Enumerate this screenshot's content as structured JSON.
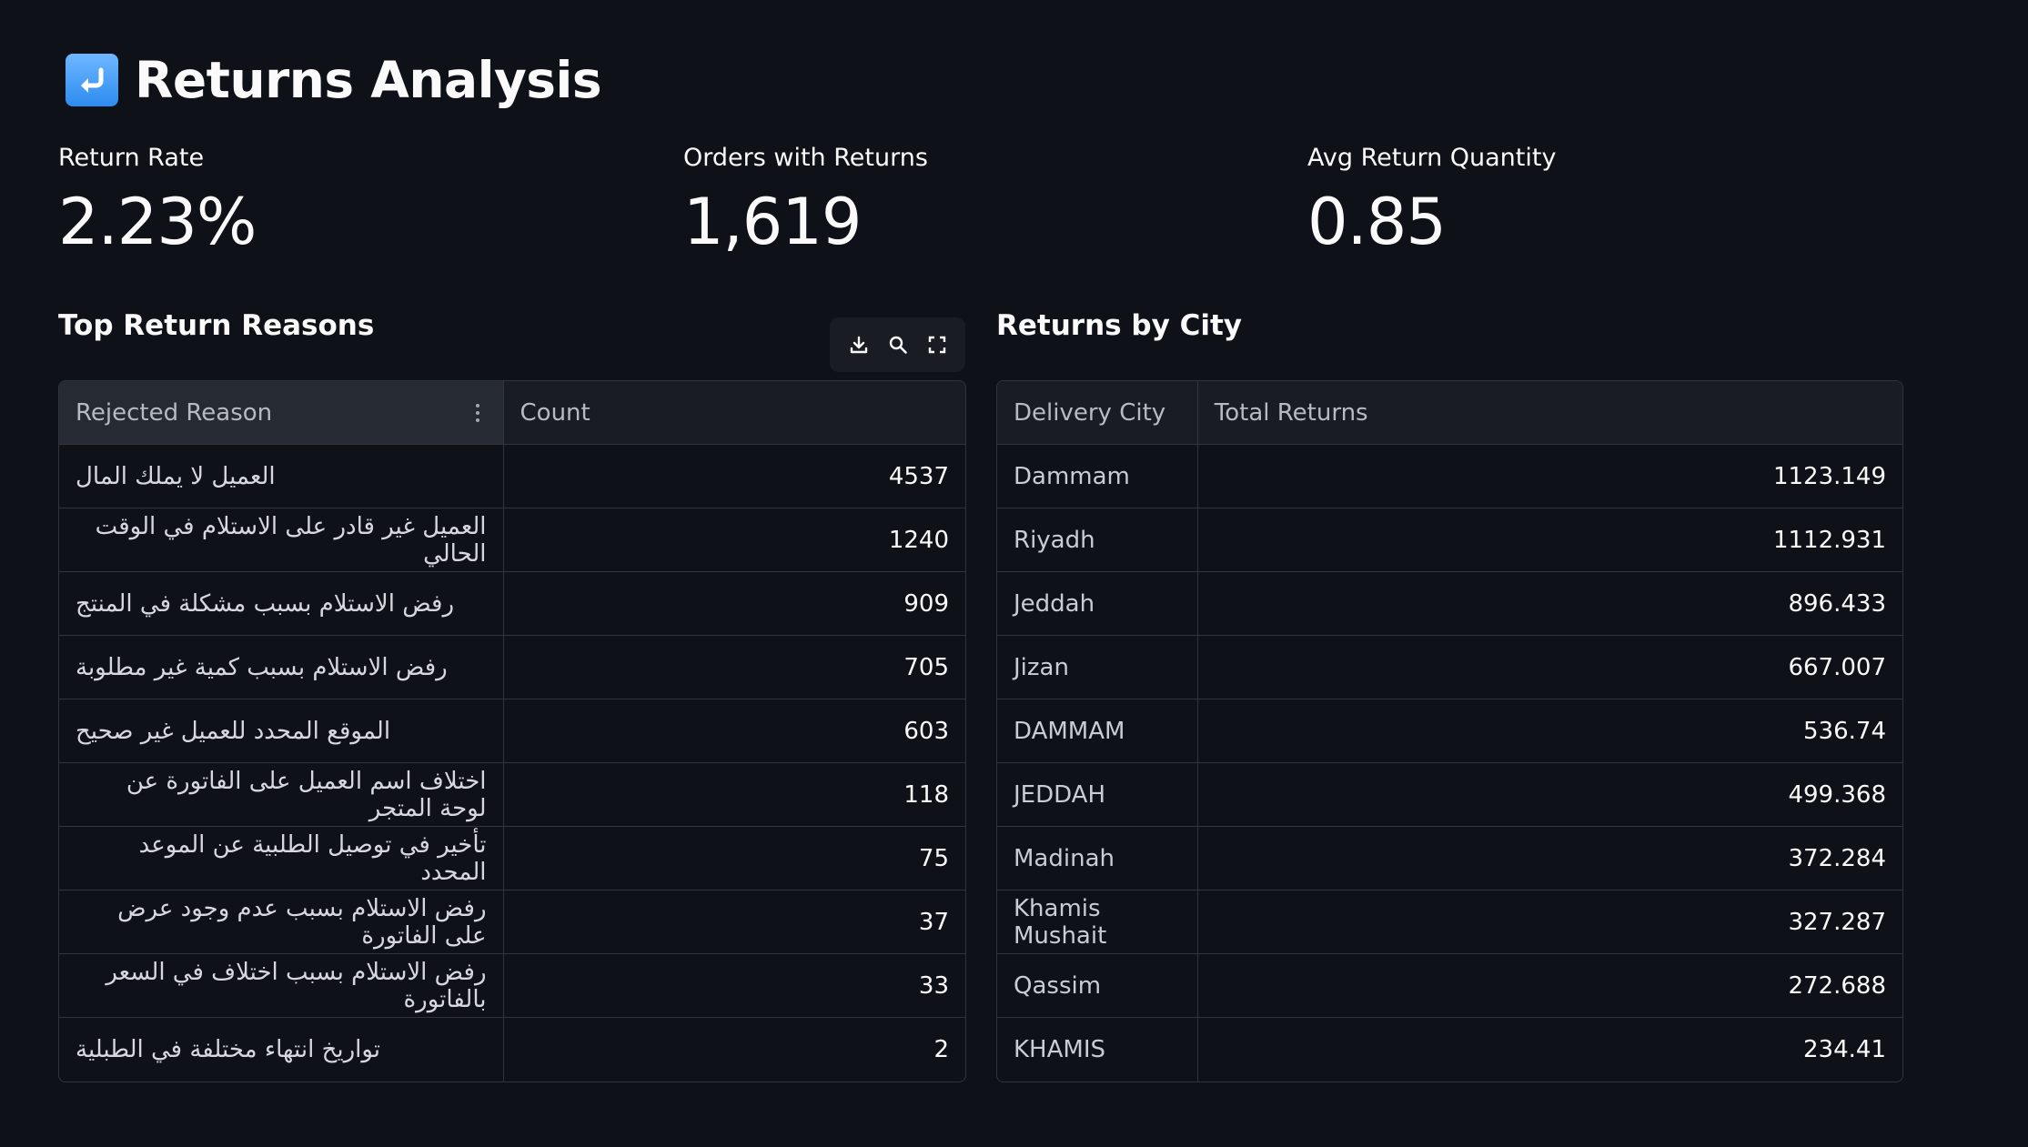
{
  "header": {
    "title": "Returns Analysis",
    "icon": "return-arrow-icon"
  },
  "metrics": [
    {
      "label": "Return Rate",
      "value": "2.23%"
    },
    {
      "label": "Orders with Returns",
      "value": "1,619"
    },
    {
      "label": "Avg Return Quantity",
      "value": "0.85"
    }
  ],
  "reasons_section": {
    "title": "Top Return Reasons",
    "toolbar": [
      "download-icon",
      "search-icon",
      "fullscreen-icon"
    ],
    "columns": [
      "Rejected Reason",
      "Count"
    ],
    "rows": [
      {
        "reason": "العميل لا يملك المال",
        "count": "4537"
      },
      {
        "reason": "العميل غير قادر على الاستلام في الوقت الحالي",
        "count": "1240"
      },
      {
        "reason": "رفض الاستلام بسبب مشكلة في المنتج",
        "count": "909"
      },
      {
        "reason": "رفض الاستلام بسبب كمية غير مطلوبة",
        "count": "705"
      },
      {
        "reason": "الموقع المحدد للعميل غير صحيح",
        "count": "603"
      },
      {
        "reason": "اختلاف اسم العميل على الفاتورة عن لوحة المتجر",
        "count": "118"
      },
      {
        "reason": "تأخير في توصيل الطلبية عن الموعد المحدد",
        "count": "75"
      },
      {
        "reason": "رفض الاستلام بسبب عدم وجود عرض على الفاتورة",
        "count": "37"
      },
      {
        "reason": "رفض الاستلام بسبب اختلاف في السعر بالفاتورة",
        "count": "33"
      },
      {
        "reason": "تواريخ انتهاء مختلفة في الطبلية",
        "count": "2"
      }
    ]
  },
  "city_section": {
    "title": "Returns by City",
    "columns": [
      "Delivery City",
      "Total Returns"
    ],
    "rows": [
      {
        "city": "Dammam",
        "total": "1123.149"
      },
      {
        "city": "Riyadh",
        "total": "1112.931"
      },
      {
        "city": "Jeddah",
        "total": "896.433"
      },
      {
        "city": "Jizan",
        "total": "667.007"
      },
      {
        "city": "DAMMAM",
        "total": "536.74"
      },
      {
        "city": "JEDDAH",
        "total": "499.368"
      },
      {
        "city": "Madinah",
        "total": "372.284"
      },
      {
        "city": "Khamis Mushait",
        "total": "327.287"
      },
      {
        "city": "Qassim",
        "total": "272.688"
      },
      {
        "city": "KHAMIS",
        "total": "234.41"
      }
    ]
  }
}
